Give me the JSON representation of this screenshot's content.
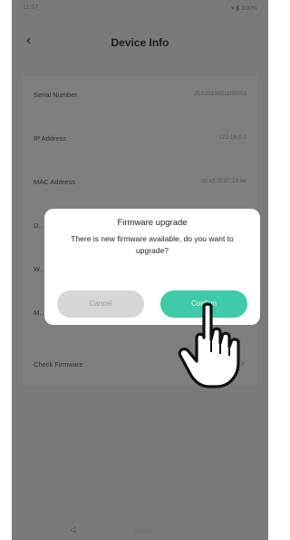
{
  "status_bar": {
    "time": "11:37",
    "indicators": "▾ ▮ 100%"
  },
  "header": {
    "back_icon": "‹",
    "title": "Device Info"
  },
  "info_rows": [
    {
      "label": "Serial Number",
      "value": "ZL02010021100003"
    },
    {
      "label": "IP Address",
      "value": "172.18.0.1"
    },
    {
      "label": "MAC Address",
      "value": "cc:a3:2f:37:19:ae"
    },
    {
      "label": "D...",
      "value": ""
    },
    {
      "label": "W...",
      "value": ""
    },
    {
      "label": "M...",
      "value": ""
    }
  ],
  "check_firmware": {
    "label": "Check Firmware",
    "chevron": "›"
  },
  "dialog": {
    "title": "Firmware upgrade",
    "message": "There is new firmware available, do you want to upgrade?",
    "cancel_label": "Cancel",
    "confirm_label": "Confirm"
  },
  "colors": {
    "accent": "#3fcba9",
    "cancel": "#d6d6d6",
    "overlay": "rgba(0,0,0,0.5)"
  },
  "icons": [
    "back-chevron",
    "chevron-right",
    "pointing-hand",
    "signal",
    "battery"
  ]
}
